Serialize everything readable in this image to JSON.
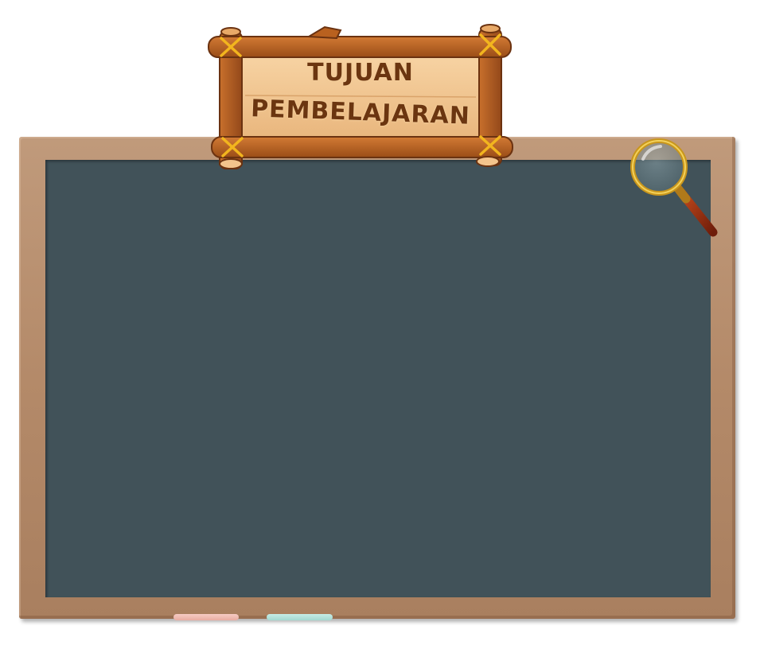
{
  "sign": {
    "line1": "TUJUAN",
    "line2": "PEMBELAJARAN"
  },
  "colors": {
    "board": "#415259",
    "frame": "#b48a69",
    "sign_text": "#6b3510",
    "chalk_pink": "#f0bab1",
    "chalk_blue": "#b5e2db",
    "rope": "#f2b51e"
  },
  "icons": {
    "magnifier": "magnifying-glass-icon"
  }
}
